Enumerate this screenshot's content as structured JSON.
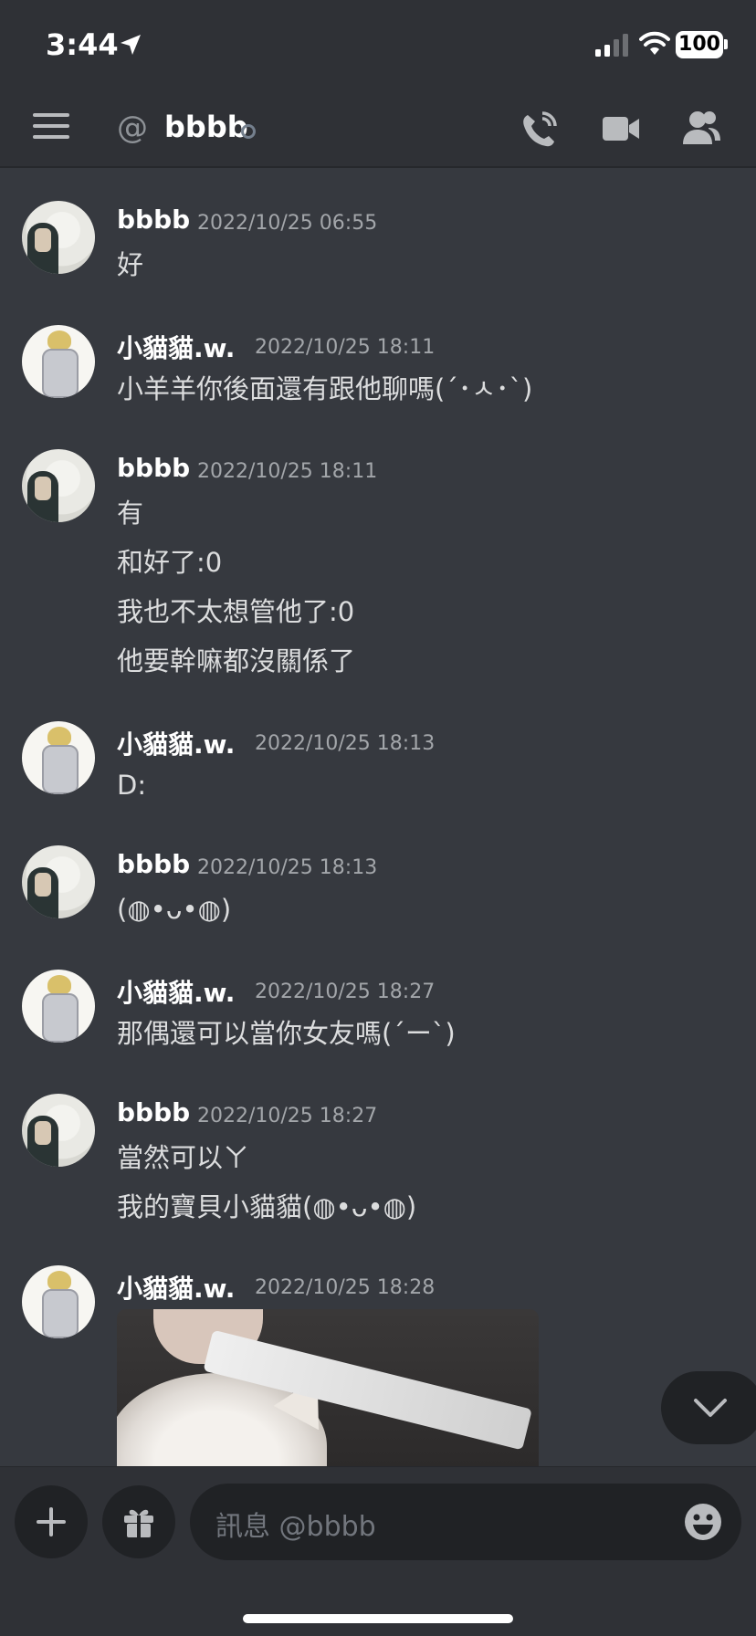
{
  "status_bar": {
    "time": "3:44",
    "battery": "100"
  },
  "header": {
    "channel_prefix": "@",
    "title": "bbbb"
  },
  "messages": [
    {
      "author": "bbbb",
      "time": "2022/10/25 06:55",
      "lines": [
        "好"
      ]
    },
    {
      "author": "小貓貓.w.",
      "time": "2022/10/25 18:11",
      "lines": [
        "小羊羊你後面還有跟他聊嗎(´･ㅅ･`)"
      ]
    },
    {
      "author": "bbbb",
      "time": "2022/10/25 18:11",
      "lines": [
        "有",
        "和好了:0",
        "我也不太想管他了:0",
        "他要幹嘛都沒關係了"
      ]
    },
    {
      "author": "小貓貓.w.",
      "time": "2022/10/25 18:13",
      "lines": [
        "D:"
      ]
    },
    {
      "author": "bbbb",
      "time": "2022/10/25 18:13",
      "lines": [
        "(◍•ᴗ•◍)"
      ]
    },
    {
      "author": "小貓貓.w.",
      "time": "2022/10/25 18:27",
      "lines": [
        "那偶還可以當你女友嗎(´ー`)"
      ]
    },
    {
      "author": "bbbb",
      "time": "2022/10/25 18:27",
      "lines": [
        "當然可以ㄚ",
        "我的寶貝小貓貓(◍•ᴗ•◍)"
      ]
    },
    {
      "author": "小貓貓.w.",
      "time": "2022/10/25 18:28",
      "lines": []
    }
  ],
  "composer": {
    "placeholder": "訊息 @bbbb"
  },
  "icons": {
    "menu": "hamburger-icon",
    "at": "at-icon",
    "call": "phone-call-icon",
    "video": "video-camera-icon",
    "members": "members-icon",
    "plus": "plus-icon",
    "gift": "gift-icon",
    "emoji": "emoji-icon",
    "scroll": "chevron-down-icon"
  },
  "colors": {
    "background": "#36393f",
    "header": "#2f3136",
    "input": "#202225",
    "text": "#dcddde",
    "muted": "#a3a6aa"
  }
}
